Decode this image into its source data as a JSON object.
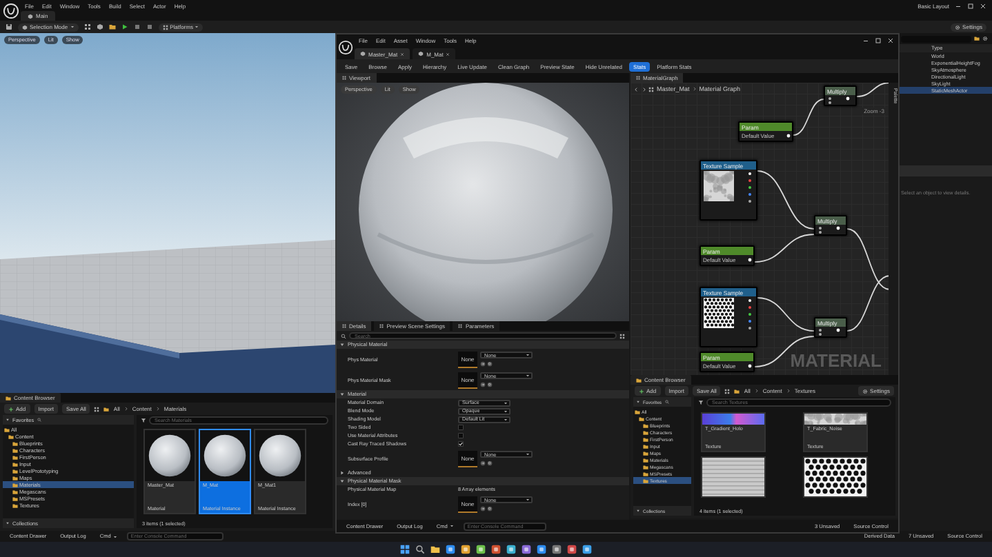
{
  "level_editor": {
    "menu": [
      "File",
      "Edit",
      "Window",
      "Tools",
      "Build",
      "Select",
      "Actor",
      "Help"
    ],
    "project_tab": "Main",
    "layout": "Basic Layout",
    "toolbar": {
      "mode": "Selection Mode",
      "platforms": "Platforms",
      "settings": "Settings"
    },
    "viewport": {
      "chips": [
        "Perspective",
        "Lit",
        "Show"
      ]
    },
    "outliner": {
      "header": "Type",
      "items": [
        {
          "label": "World",
          "selected": false
        },
        {
          "label": "ExponentialHeightFog",
          "selected": false
        },
        {
          "label": "SkyAtmosphere",
          "selected": false
        },
        {
          "label": "DirectionalLight",
          "selected": false
        },
        {
          "label": "SkyLight",
          "selected": false
        },
        {
          "label": "StaticMeshActor",
          "selected": true
        }
      ]
    },
    "details_hint": "Select an object to view details.",
    "content_browser": {
      "tab": "Content Browser",
      "buttons": [
        "Add",
        "Import",
        "Save All"
      ],
      "path": [
        "All",
        "Content",
        "Materials"
      ],
      "tree_header": "Favorites",
      "tree": [
        {
          "label": "All",
          "selected": false,
          "children": [
            {
              "label": "Content",
              "selected": false,
              "children": [
                {
                  "label": "Blueprints",
                  "selected": false
                },
                {
                  "label": "Characters",
                  "selected": false
                },
                {
                  "label": "FirstPerson",
                  "selected": false
                },
                {
                  "label": "Input",
                  "selected": false
                },
                {
                  "label": "LevelPrototyping",
                  "selected": false
                },
                {
                  "label": "Maps",
                  "selected": false
                },
                {
                  "label": "Materials",
                  "selected": true
                },
                {
                  "label": "Megascans",
                  "selected": false
                },
                {
                  "label": "MSPresets",
                  "selected": false
                },
                {
                  "label": "Textures",
                  "selected": false
                }
              ]
            }
          ]
        }
      ],
      "collections": "Collections",
      "search_placeholder": "Search Materials",
      "assets": [
        {
          "name": "Master_Mat",
          "type": "Material",
          "kind": "sphere",
          "selected": false
        },
        {
          "name": "M_Mat",
          "type": "Material Instance",
          "kind": "sphere",
          "selected": true
        },
        {
          "name": "M_Mat1",
          "type": "Material Instance",
          "kind": "sphere",
          "selected": false
        }
      ],
      "status": "3 items (1 selected)"
    },
    "status_bar": {
      "left": [
        "Content Drawer",
        "Output Log"
      ],
      "cmd": "Cmd",
      "cmd_placeholder": "Enter Console Command",
      "right": [
        "Derived Data",
        "7 Unsaved",
        "Source Control"
      ]
    }
  },
  "material_editor": {
    "menu": [
      "File",
      "Edit",
      "Asset",
      "Window",
      "Tools",
      "Help"
    ],
    "tabs": [
      {
        "label": "Master_Mat",
        "selected": true
      },
      {
        "label": "M_Mat",
        "selected": false
      }
    ],
    "toolbar": [
      {
        "label": "Save",
        "selected": false
      },
      {
        "label": "Browse",
        "selected": false
      },
      {
        "label": "Apply",
        "selected": false
      },
      {
        "label": "Hierarchy",
        "selected": false
      },
      {
        "label": "Live Update",
        "selected": false
      },
      {
        "label": "Clean Graph",
        "selected": false
      },
      {
        "label": "Preview State",
        "selected": false
      },
      {
        "label": "Hide Unrelated",
        "selected": false
      },
      {
        "label": "Stats",
        "selected": true
      },
      {
        "label": "Platform Stats",
        "selected": false
      }
    ],
    "viewport": {
      "tab": "Viewport",
      "chips": [
        "Perspective",
        "Lit",
        "Show"
      ]
    },
    "details": {
      "tabs": [
        {
          "label": "Details",
          "selected": true
        },
        {
          "label": "Preview Scene Settings",
          "selected": false
        },
        {
          "label": "Parameters",
          "selected": false
        }
      ],
      "search_placeholder": "Search",
      "sections": [
        {
          "title": "Physical Material",
          "expanded": true,
          "rows": [
            {
              "kind": "asset",
              "label": "Phys Material",
              "value": "None",
              "thumb": "None"
            },
            {
              "kind": "asset",
              "label": "Phys Material Mask",
              "value": "None",
              "thumb": "None"
            }
          ]
        },
        {
          "title": "Material",
          "expanded": true,
          "rows": [
            {
              "kind": "dropdown",
              "label": "Material Domain",
              "value": "Surface"
            },
            {
              "kind": "dropdown",
              "label": "Blend Mode",
              "value": "Opaque"
            },
            {
              "kind": "dropdown",
              "label": "Shading Model",
              "value": "Default Lit"
            },
            {
              "kind": "checkbox",
              "label": "Two Sided",
              "checked": false
            },
            {
              "kind": "checkbox",
              "label": "Use Material Attributes",
              "checked": false
            },
            {
              "kind": "checkbox",
              "label": "Cast Ray Traced Shadows",
              "checked": true
            },
            {
              "kind": "asset",
              "label": "Subsurface Profile",
              "value": "None",
              "thumb": "None"
            }
          ]
        },
        {
          "title": "Advanced",
          "expanded": false
        },
        {
          "title": "Physical Material Mask",
          "expanded": true,
          "rows": [
            {
              "kind": "text",
              "label": "Physical Material Map",
              "value": "8 Array elements"
            },
            {
              "kind": "asset",
              "label": "Index [0]",
              "value": "None",
              "thumb": "None"
            }
          ]
        }
      ]
    },
    "graph": {
      "tab": "MaterialGraph",
      "breadcrumb": [
        "Master_Mat",
        "Material Graph"
      ],
      "zoom": "Zoom -3",
      "palette": "Palette",
      "label": "MATERIAL",
      "nodes": [
        {
          "kind": "param",
          "title": "Param",
          "pin": "Default Value"
        },
        {
          "kind": "math",
          "title": "Multiply"
        },
        {
          "kind": "texture",
          "title": "Texture Sample",
          "thumbnail": {
            "kind": "noise"
          }
        },
        {
          "kind": "param",
          "title": "Param",
          "pin": "Default Value"
        },
        {
          "kind": "math",
          "title": "Multiply"
        },
        {
          "kind": "texture",
          "title": "Texture Sample",
          "thumbnail": {
            "kind": "dots"
          }
        },
        {
          "kind": "param",
          "title": "Param",
          "pin": "Default Value"
        },
        {
          "kind": "math",
          "title": "Multiply"
        }
      ]
    },
    "content_browser": {
      "tab": "Content Browser",
      "buttons": [
        "Add",
        "Import",
        "Save All"
      ],
      "path": [
        "All",
        "Content",
        "Textures"
      ],
      "settings": "Settings",
      "tree_header": "Favorites",
      "tree": [
        {
          "label": "All",
          "selected": false,
          "children": [
            {
              "label": "Content",
              "selected": false,
              "children": [
                {
                  "label": "Blueprints",
                  "selected": false
                },
                {
                  "label": "Characters",
                  "selected": false
                },
                {
                  "label": "FirstPerson",
                  "selected": false
                },
                {
                  "label": "Input",
                  "selected": false
                },
                {
                  "label": "Maps",
                  "selected": false
                },
                {
                  "label": "Materials",
                  "selected": false
                },
                {
                  "label": "Megascans",
                  "selected": false
                },
                {
                  "label": "MSPresets",
                  "selected": false
                },
                {
                  "label": "Textures",
                  "selected": true
                }
              ]
            }
          ]
        }
      ],
      "collections": "Collections",
      "search_placeholder": "Search Textures",
      "assets": [
        {
          "name": "T_Gradient_Holo",
          "type": "Texture",
          "kind": "gradient",
          "selected": false
        },
        {
          "name": "T_Fabric_Noise",
          "type": "Texture",
          "kind": "noise",
          "selected": false
        },
        {
          "kind": "stripes",
          "selected": false
        },
        {
          "kind": "dots",
          "selected": false
        }
      ],
      "status": "4 items (1 selected)"
    },
    "status_bar": {
      "left": [
        "Content Drawer",
        "Output Log"
      ],
      "cmd": "Cmd",
      "cmd_placeholder": "Enter Console Command",
      "right": [
        "3 Unsaved",
        "Source Control"
      ]
    }
  }
}
